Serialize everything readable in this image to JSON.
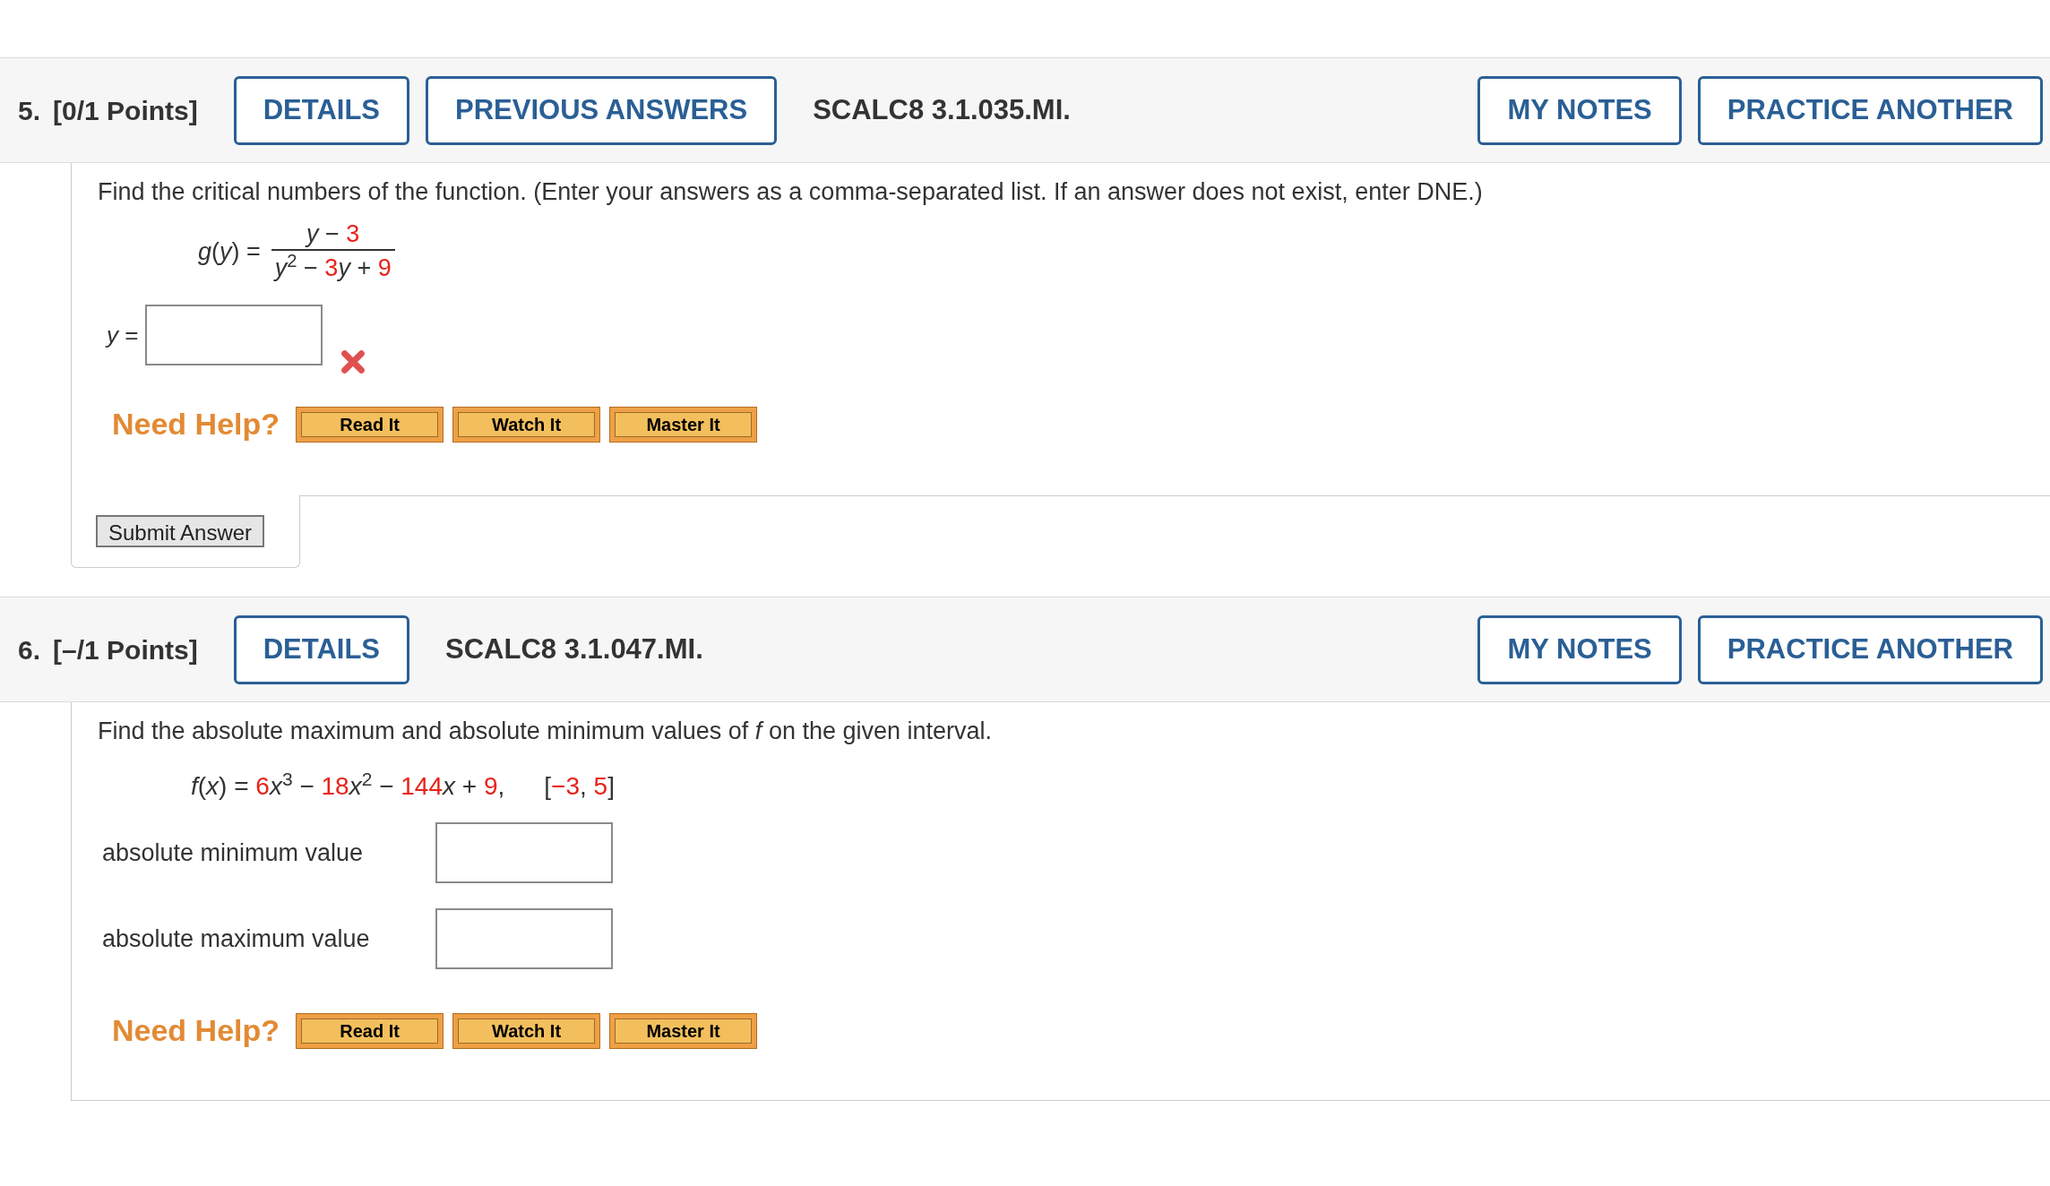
{
  "questions": [
    {
      "number": "5.",
      "points": "[0/1 Points]",
      "left_buttons": [
        "DETAILS",
        "PREVIOUS ANSWERS"
      ],
      "code": "SCALC8 3.1.035.MI.",
      "right_buttons": [
        "MY NOTES",
        "PRACTICE ANOTHER"
      ],
      "prompt": "Find the critical numbers of the function. (Enter your answers as a comma-separated list. If an answer does not exist, enter DNE.)",
      "formula": {
        "kind": "fraction",
        "lhs": "*g*(*y*) =",
        "numerator": [
          {
            "text": "*y* − ",
            "red": false
          },
          {
            "text": "3",
            "red": true
          }
        ],
        "denominator": [
          {
            "text": "*y*$^{2}$ − ",
            "red": false
          },
          {
            "text": "3",
            "red": true
          },
          {
            "text": "*y* + ",
            "red": false
          },
          {
            "text": "9",
            "red": true
          }
        ]
      },
      "fields": [
        {
          "kind": "math",
          "label": "*y* =",
          "incorrect": true
        }
      ],
      "need_help": {
        "label": "Need Help?",
        "buttons": [
          "Read It",
          "Watch It",
          "Master It"
        ]
      },
      "submit": "Submit Answer"
    },
    {
      "number": "6.",
      "points": "[–/1 Points]",
      "left_buttons": [
        "DETAILS"
      ],
      "code": "SCALC8 3.1.047.MI.",
      "right_buttons": [
        "MY NOTES",
        "PRACTICE ANOTHER"
      ],
      "prompt": "Find the absolute maximum and absolute minimum values of *f* on the given interval.",
      "formula": {
        "kind": "inline",
        "expression": [
          {
            "text": "*f*(*x*) = ",
            "red": false
          },
          {
            "text": "6",
            "red": true
          },
          {
            "text": "*x*$^{3}$ − ",
            "red": false
          },
          {
            "text": "18",
            "red": true
          },
          {
            "text": "*x*$^{2}$ − ",
            "red": false
          },
          {
            "text": "144",
            "red": true
          },
          {
            "text": "*x* + ",
            "red": false
          },
          {
            "text": "9",
            "red": true
          },
          {
            "text": ",",
            "red": false
          }
        ],
        "interval": [
          {
            "text": "[",
            "red": false
          },
          {
            "text": "−3",
            "red": true
          },
          {
            "text": ", ",
            "red": false
          },
          {
            "text": "5",
            "red": true
          },
          {
            "text": "]",
            "red": false
          }
        ]
      },
      "fields": [
        {
          "kind": "text",
          "label": "absolute minimum value",
          "incorrect": false
        },
        {
          "kind": "text",
          "label": "absolute maximum value",
          "incorrect": false
        }
      ],
      "need_help": {
        "label": "Need Help?",
        "buttons": [
          "Read It",
          "Watch It",
          "Master It"
        ]
      }
    }
  ]
}
